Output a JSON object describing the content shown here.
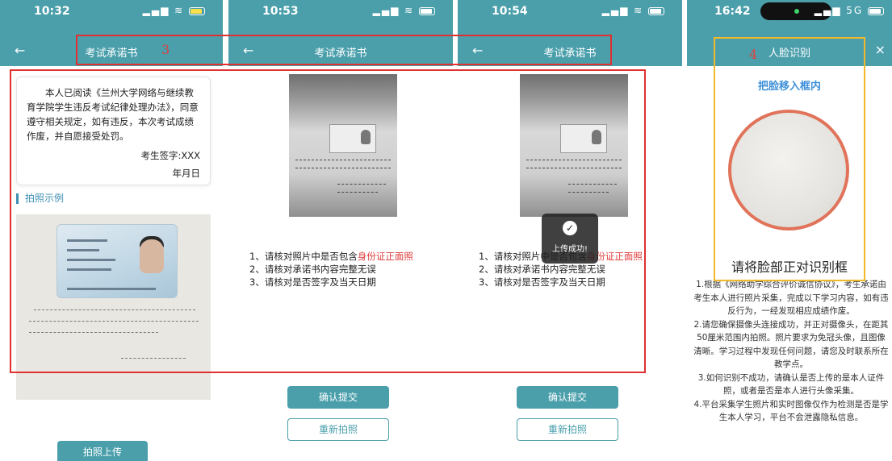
{
  "screens": [
    {
      "time": "10:32",
      "title": "考试承诺书",
      "back": "←",
      "annotation_number": "3",
      "pledge": {
        "text": "本人已阅读《兰州大学网络与继续教育学院学生违反考试纪律处理办法》，同意遵守相关规定，如有违反，本次考试成绩作废，并自愿接受处罚。",
        "signature": "考生签字:XXX",
        "date": "年月日"
      },
      "section_label": "拍照示例",
      "button_upload": "拍照上传"
    },
    {
      "time": "10:53",
      "title": "考试承诺书",
      "back": "←",
      "checklist": [
        {
          "before": "1、请核对照片中是否包含",
          "highlight": "身份证正面照"
        },
        {
          "before": "2、请核对承诺书内容完整无误",
          "highlight": ""
        },
        {
          "before": "3、请核对是否签字及当天日期",
          "highlight": ""
        }
      ],
      "button_confirm": "确认提交",
      "button_retake": "重新拍照"
    },
    {
      "time": "10:54",
      "title": "考试承诺书",
      "back": "←",
      "checklist": [
        {
          "before": "1、请核对照片中是否包含",
          "highlight": "身份证正面照"
        },
        {
          "before": "2、请核对承诺书内容完整无误",
          "highlight": ""
        },
        {
          "before": "3、请核对是否签字及当天日期",
          "highlight": ""
        }
      ],
      "toast": {
        "icon": "check-icon",
        "text": "上传成功!"
      },
      "button_confirm": "确认提交",
      "button_retake": "重新拍照"
    },
    {
      "time": "16:42",
      "network": "5G",
      "title": "人脸识别",
      "close": "×",
      "annotation_number": "4",
      "hint": "把脸移入框内",
      "heading": "请将脸部正对识别框",
      "notes": [
        "1.根据《网络助学综合评价诚信协议》，考生承诺由考生本人进行照片采集，完成以下学习内容，如有违反行为，一经发现相应成绩作废。",
        "2.请您确保摄像头连接成功，并正对摄像头，在距其50厘米范围内拍照。照片要求为免冠头像，且图像清晰。学习过程中发现任何问题，请您及时联系所在教学点。",
        "3.如何识别不成功，请确认是否上传的是本人证件照，或者是否是本人进行头像采集。",
        "4.平台采集学生照片和实时图像仅作为检测是否是学生本人学习，平台不会泄露隐私信息。"
      ]
    }
  ],
  "colors": {
    "header": "#4a9fab",
    "annotation_red": "#e03030",
    "annotation_yellow": "#f2b829",
    "highlight": "#e03c3c",
    "face_ring": "#e0735a"
  }
}
